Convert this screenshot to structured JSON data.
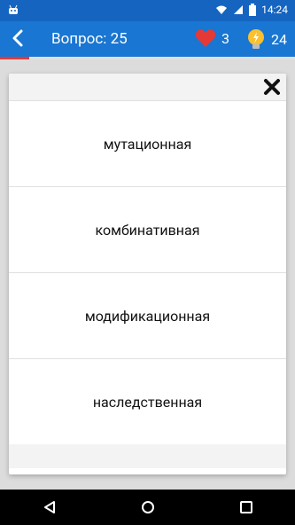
{
  "statusbar": {
    "time": "14:24"
  },
  "appbar": {
    "title": "Вопрос: 25",
    "hearts_count": "3",
    "hints_count": "24"
  },
  "progress": {
    "fraction": 0.1
  },
  "dialog": {
    "options": [
      {
        "label": "мутационная"
      },
      {
        "label": "комбинативная"
      },
      {
        "label": "модификационная"
      },
      {
        "label": "наследственная"
      }
    ]
  },
  "colors": {
    "statusbar": "#1565c0",
    "appbar": "#1976d2",
    "progress_fill": "#e53935",
    "heart": "#e53935",
    "bulb": "#fbc02d"
  },
  "icons": {
    "status_left": "android-icon",
    "status_right": [
      "wifi-icon",
      "signal-icon",
      "battery-icon"
    ],
    "back": "chevron-left-icon",
    "hearts": "heart-icon",
    "hints": "lightbulb-icon",
    "close": "close-icon",
    "nav": [
      "back-triangle-icon",
      "home-circle-icon",
      "recents-square-icon"
    ]
  }
}
